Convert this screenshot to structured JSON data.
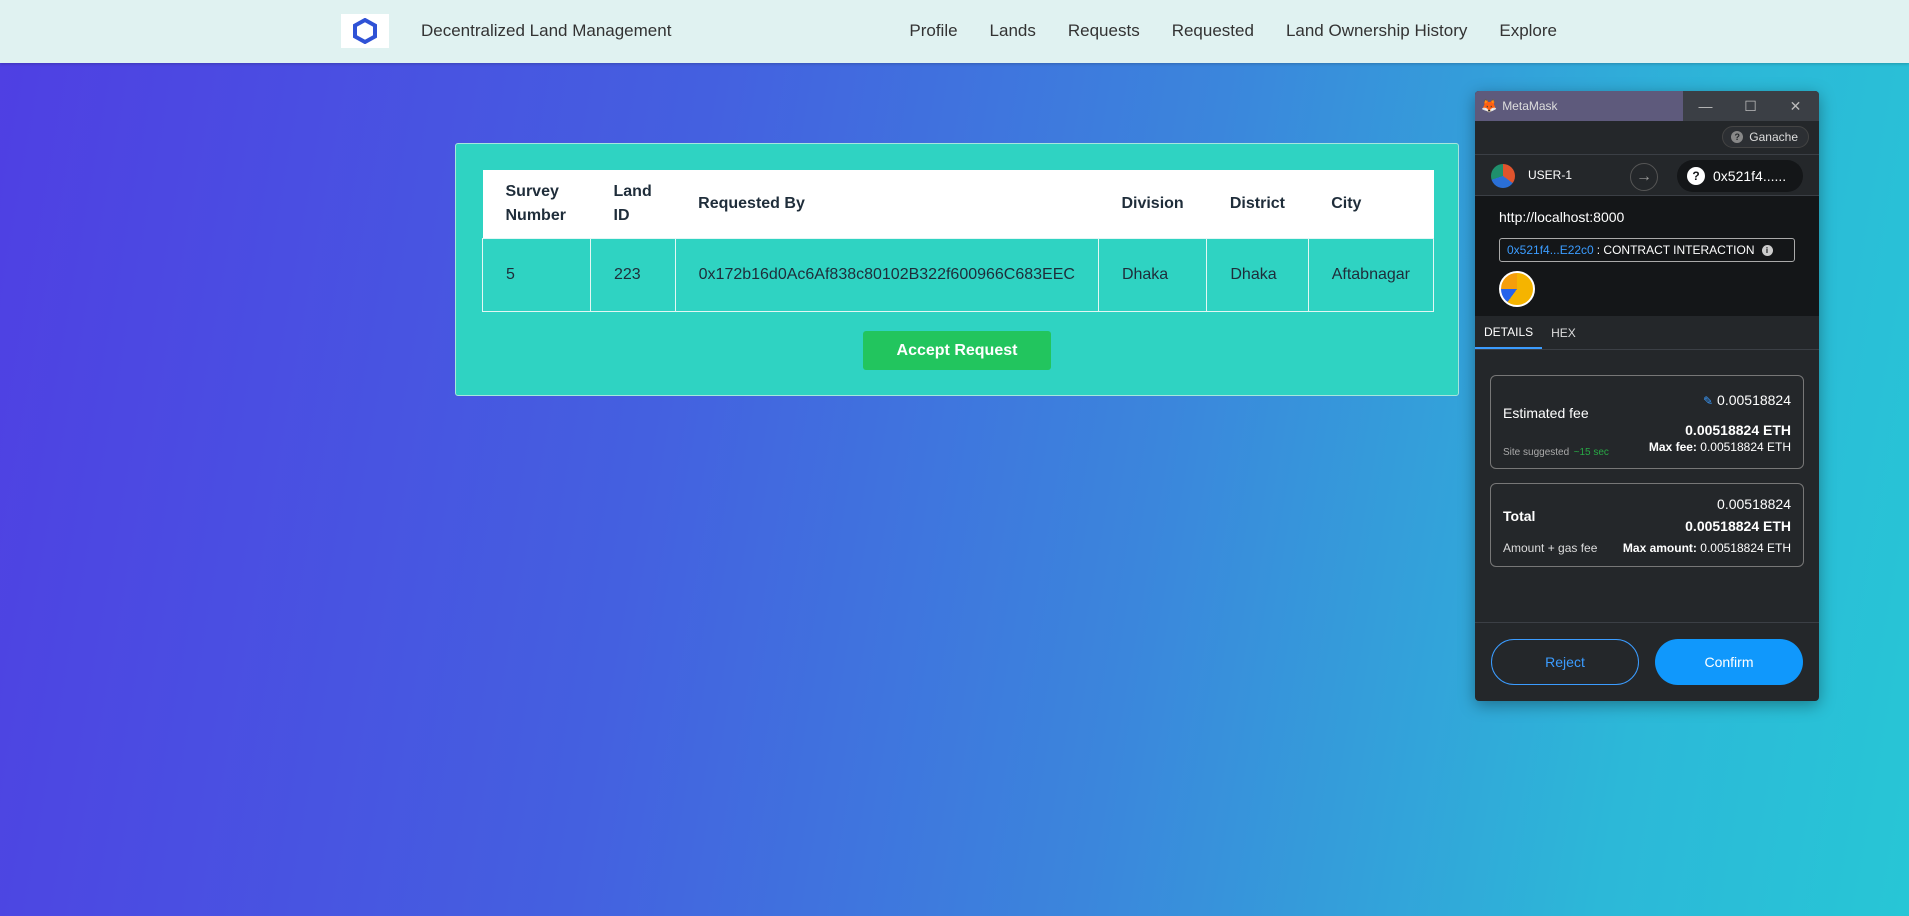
{
  "navbar": {
    "brand": "Decentralized Land Management",
    "links": [
      "Profile",
      "Lands",
      "Requests",
      "Requested",
      "Land Ownership History",
      "Explore"
    ]
  },
  "table": {
    "headers": [
      "Survey Number",
      "Land ID",
      "Requested By",
      "Division",
      "District",
      "City"
    ],
    "rows": [
      [
        "5",
        "223",
        "0x172b16d0Ac6Af838c80102B322f600966C683EEC",
        "Dhaka",
        "Dhaka",
        "Aftabnagar"
      ]
    ]
  },
  "accept_label": "Accept Request",
  "metamask": {
    "window_title": "MetaMask",
    "network": "Ganache",
    "account_name": "USER-1",
    "to_address": "0x521f4......",
    "site_url": "http://localhost:8000",
    "contract_address": "0x521f4...E22c0",
    "contract_label": ": CONTRACT INTERACTION",
    "tabs": [
      "DETAILS",
      "HEX"
    ],
    "estimated_fee_label": "Estimated fee",
    "estimated_fee_value": "0.00518824",
    "estimated_fee_eth": "0.00518824 ETH",
    "site_suggested": "Site suggested",
    "time_estimate": "~15 sec",
    "max_fee_label": "Max fee:",
    "max_fee_value": "0.00518824 ETH",
    "total_label": "Total",
    "total_value": "0.00518824",
    "total_eth": "0.00518824 ETH",
    "amount_gas_label": "Amount + gas fee",
    "max_amount_label": "Max amount:",
    "max_amount_value": "0.00518824 ETH",
    "reject_label": "Reject",
    "confirm_label": "Confirm"
  },
  "colors": {
    "card_bg": "#2fd3c2",
    "accept_button": "#22c55e",
    "confirm_button": "#1098fc",
    "metamask_bg": "#24272a"
  }
}
